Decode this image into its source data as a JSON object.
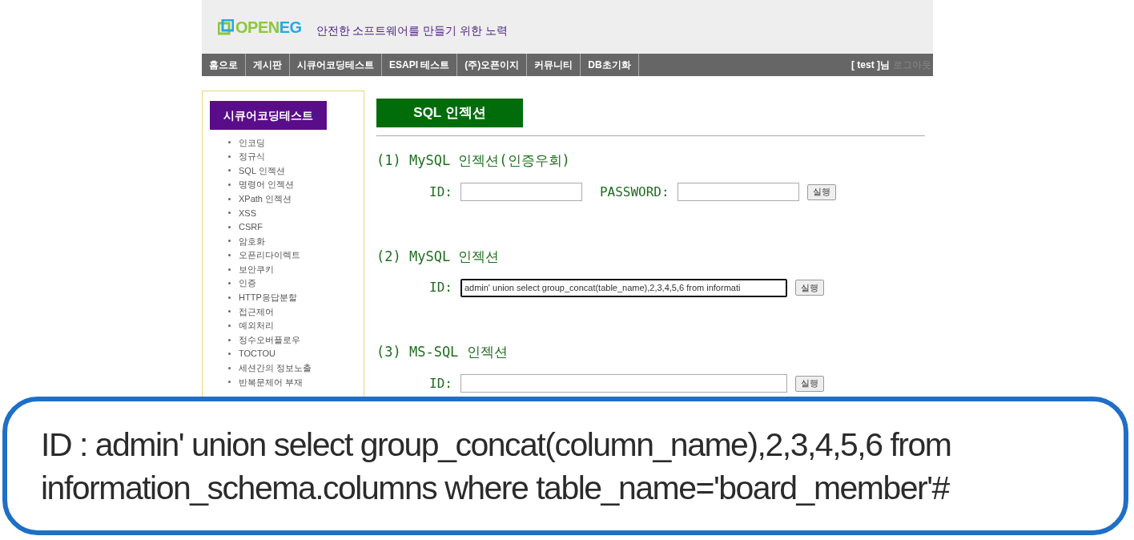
{
  "header": {
    "logo": [
      "OPEN",
      "EG"
    ],
    "tagline": "안전한 소프트웨어를 만들기 위한 노력"
  },
  "nav": {
    "items": [
      "홈으로",
      "게시판",
      "시큐어코딩테스트",
      "ESAPI 테스트",
      "(주)오픈이지",
      "커뮤니티",
      "DB초기화"
    ],
    "user": "[ test ]님",
    "logout": "로그아웃"
  },
  "sidebar": {
    "title": "시큐어코딩테스트",
    "items": [
      "인코딩",
      "정규식",
      "SQL 인젝션",
      "명령어 인젝션",
      "XPath 인젝션",
      "XSS",
      "CSRF",
      "암호화",
      "오픈리다이렉트",
      "보안쿠키",
      "인증",
      "HTTP응답분할",
      "접근제어",
      "예외처리",
      "정수오버플로우",
      "TOCTOU",
      "세션간의 정보노출",
      "반복문제어 부재"
    ]
  },
  "main": {
    "title": "SQL 인젝션",
    "sections": [
      {
        "title": "(1) MySQL 인젝션(인증우회)",
        "fields": [
          {
            "label": "ID:"
          },
          {
            "label": "PASSWORD:"
          }
        ],
        "button": "실행"
      },
      {
        "title": "(2) MySQL 인젝션",
        "fields": [
          {
            "label": "ID:",
            "value": "admin' union select group_concat(table_name),2,3,4,5,6 from informati",
            "focused": true
          }
        ],
        "button": "실행"
      },
      {
        "title": "(3) MS-SQL 인젝션",
        "fields": [
          {
            "label": "ID:"
          }
        ],
        "button": "실행"
      }
    ]
  },
  "caption": "ID : admin' union select group_concat(column_name),2,3,4,5,6 from information_schema.columns where table_name='board_member'#"
}
